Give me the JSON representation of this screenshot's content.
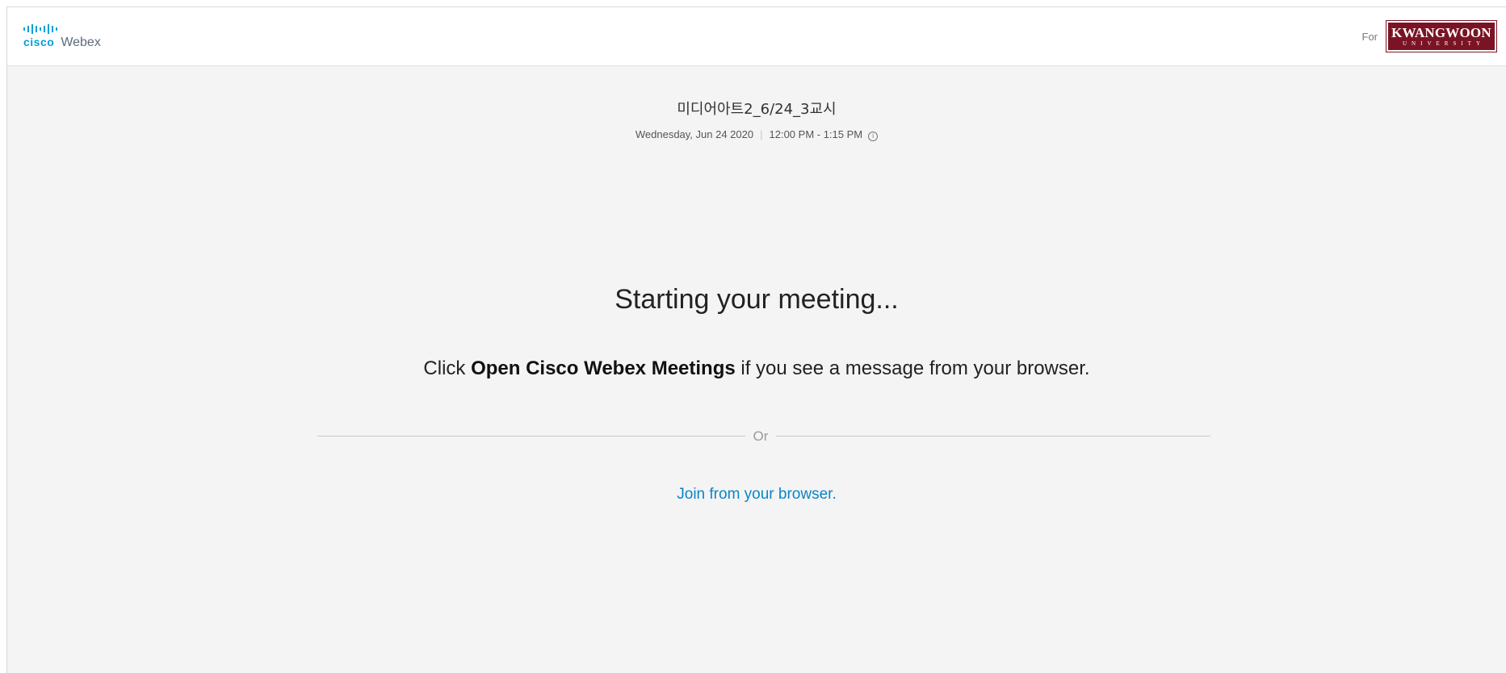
{
  "header": {
    "brand_cisco": "cisco",
    "brand_webex": "Webex",
    "for_label": "For",
    "org_logo_name": "KWANGWOON",
    "org_logo_sub": "UNIVERSITY"
  },
  "meeting": {
    "title": "미디어아트2_6/24_3교시",
    "date": "Wednesday, Jun 24 2020",
    "separator": "|",
    "time": "12:00 PM - 1:15 PM",
    "info_icon": "i"
  },
  "main": {
    "status": "Starting your meeting...",
    "instruction_prefix": "Click ",
    "instruction_bold": "Open Cisco Webex Meetings",
    "instruction_suffix": " if you see a message from your browser.",
    "divider_label": "Or",
    "join_link": "Join from your browser."
  },
  "icons": {
    "cisco_logo": "cisco-bars-icon",
    "info": "info-icon"
  },
  "colors": {
    "brand_blue": "#049fd9",
    "link_blue": "#0a85c7",
    "kw_maroon": "#7a1424",
    "background": "#f4f4f4"
  }
}
